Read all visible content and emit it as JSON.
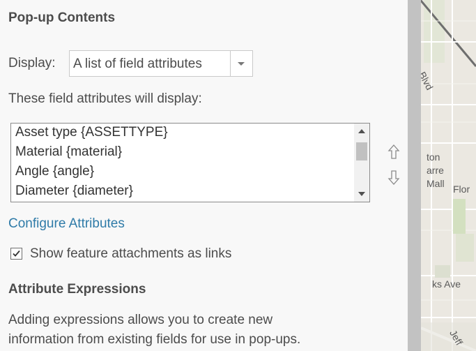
{
  "popup": {
    "heading": "Pop-up Contents",
    "display_label": "Display:",
    "display_value": "A list of field attributes",
    "fields_label": "These field attributes will display:",
    "fields": [
      "Asset type {ASSETTYPE}",
      "Material {material}",
      "Angle {angle}",
      "Diameter {diameter}"
    ],
    "configure_link": "Configure Attributes",
    "attachments_label": "Show feature attachments as links",
    "attachments_checked": true
  },
  "expressions": {
    "heading": "Attribute Expressions",
    "description_line1": "Adding expressions allows you to create new",
    "description_line2": "information from existing fields for use in pop-ups."
  },
  "map": {
    "labels": [
      "Blvd",
      "ton",
      "arre",
      "Mall",
      "Flor",
      "ks Ave",
      "Jeff"
    ]
  },
  "icons": {
    "move_up": "arrow-up-icon",
    "move_down": "arrow-down-icon",
    "dropdown": "chevron-down-icon",
    "checkbox": "checkmark-icon"
  }
}
